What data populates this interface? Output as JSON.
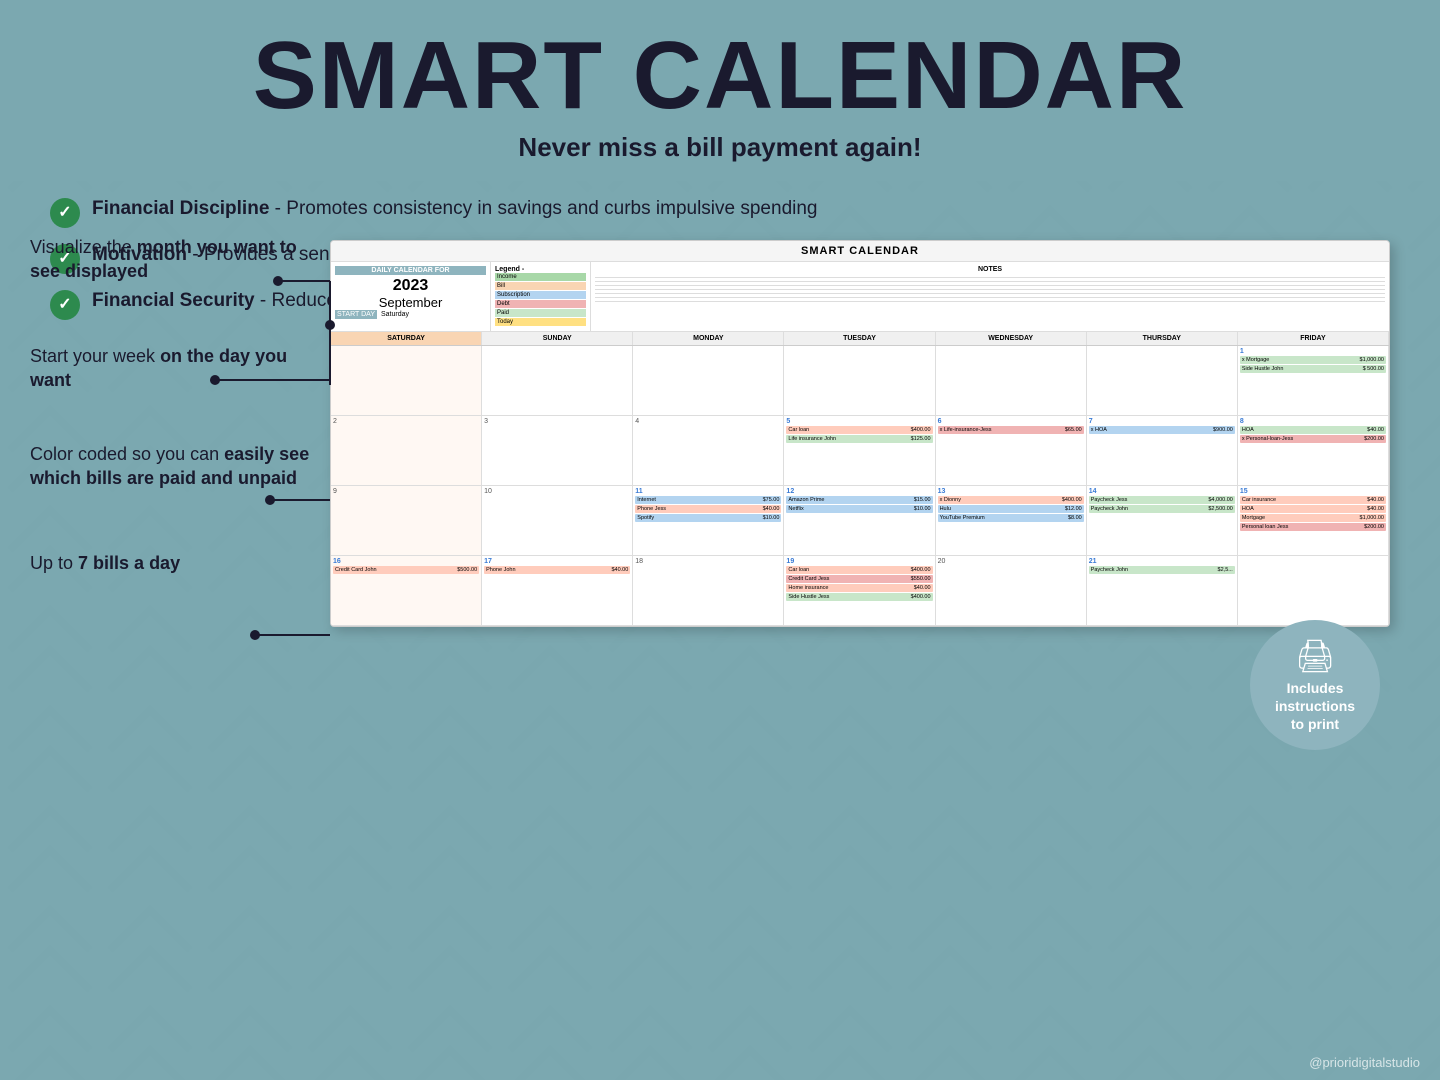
{
  "header": {
    "title": "SMART CALENDAR",
    "subtitle": "Never miss a bill payment again!"
  },
  "calendar": {
    "title": "SMART CALENDAR",
    "info_label": "DAILY CALENDAR FOR",
    "year": "2023",
    "month": "September",
    "start_day_label": "START DAY",
    "start_day_value": "Saturday",
    "legend_label": "Legend:",
    "legend_items": [
      {
        "label": "Income",
        "class": "legend-income"
      },
      {
        "label": "Bill",
        "class": "legend-bill"
      },
      {
        "label": "Subscription",
        "class": "legend-subscription"
      },
      {
        "label": "Debt",
        "class": "legend-debt"
      },
      {
        "label": "Paid",
        "class": "legend-paid"
      },
      {
        "label": "Today",
        "class": "legend-today"
      }
    ],
    "notes_label": "NOTES",
    "day_headers": [
      "SATURDAY",
      "SUNDAY",
      "MONDAY",
      "TUESDAY",
      "WEDNESDAY",
      "THURSDAY",
      "FRIDAY"
    ]
  },
  "annotations": [
    {
      "text": "Visualize the ",
      "bold": "month you want to see displayed"
    },
    {
      "text": "Start your week ",
      "bold": "on the day you want"
    },
    {
      "text": "Color coded so you can ",
      "bold": "easily see which bills are paid and unpaid"
    },
    {
      "text": "Up to ",
      "bold": "7 bills a day"
    }
  ],
  "includes": {
    "icon": "🖨",
    "line1": "Includes",
    "line2": "instructions",
    "line3": "to print"
  },
  "bullets": [
    {
      "bold": "Financial Discipline",
      "text": " - Promotes consistency in savings and curbs impulsive spending"
    },
    {
      "bold": "Motivation",
      "text": " - Provides a sense of purpose, encourages tracking progress, and guides financially sound decisions."
    },
    {
      "bold": "Financial Security",
      "text": " - Reduces financial stress, equips you to handle unexpected expenses, and aids in achieving major life milestones."
    }
  ],
  "watermark": "@prioridigitalstudio"
}
